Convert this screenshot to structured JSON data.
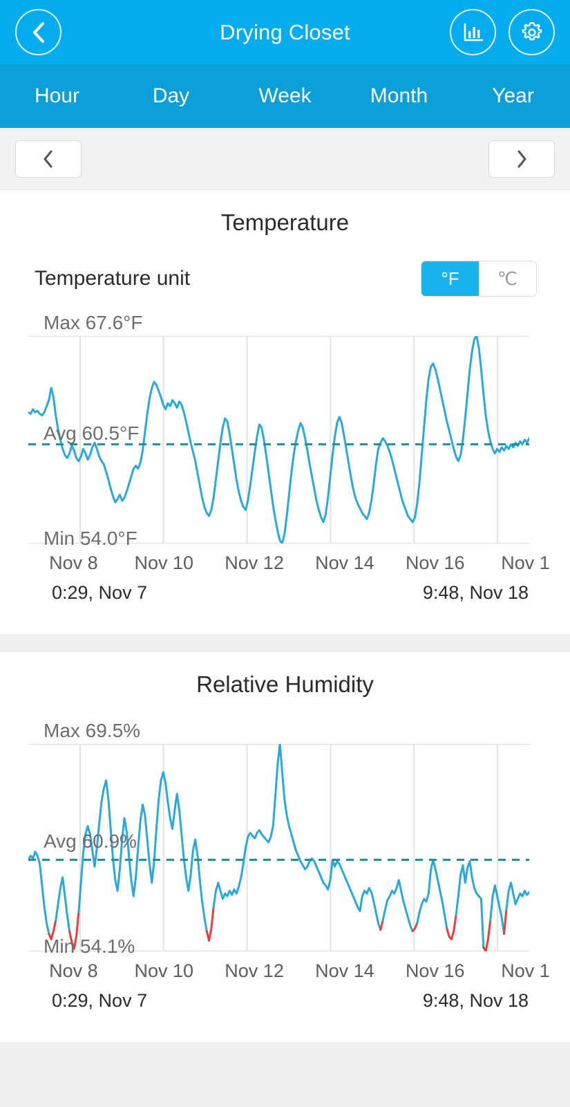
{
  "appbar": {
    "title": "Drying Closet",
    "back_icon": "chevron-left-icon",
    "chart_icon": "bar-chart-icon",
    "settings_icon": "gear-icon",
    "bg_color": "#05aced"
  },
  "tabs": [
    {
      "label": "Hour",
      "active": false
    },
    {
      "label": "Day",
      "active": false
    },
    {
      "label": "Week",
      "active": false
    },
    {
      "label": "Month",
      "active": false
    },
    {
      "label": "Year",
      "active": false
    }
  ],
  "pager": {
    "prev_icon": "chevron-left-icon",
    "next_icon": "chevron-right-icon"
  },
  "temperature_card": {
    "title": "Temperature",
    "unit_label": "Temperature unit",
    "unit_options": [
      {
        "label": "°F",
        "selected": true
      },
      {
        "label": "℃",
        "selected": false
      }
    ],
    "max_label": "Max 67.6°F",
    "avg_label": "Avg 60.5°F",
    "min_label": "Min 54.0°F",
    "range_start": "0:29, Nov 7",
    "range_end": "9:48, Nov 18"
  },
  "humidity_card": {
    "title": "Relative Humidity",
    "max_label": "Max 69.5%",
    "avg_label": "Avg 60.9%",
    "min_label": "Min 54.1%",
    "range_start": "0:29, Nov 7",
    "range_end": "9:48, Nov 18"
  },
  "colors": {
    "accent": "#05aced",
    "line_blue": "#29a8dc",
    "line_red": "#ee3b3b",
    "avg_dash": "#1f8ca8",
    "grid": "#dcdcdc"
  },
  "chart_data": [
    {
      "type": "line",
      "title": "Temperature",
      "ylabel": "°F",
      "xlabel": "",
      "grid": true,
      "legend": "none",
      "ylim": [
        54.0,
        67.6
      ],
      "stats": {
        "max": 67.6,
        "avg": 60.5,
        "min": 54.0,
        "unit": "°F"
      },
      "x_tick_labels": [
        "Nov 8",
        "Nov 10",
        "Nov 12",
        "Nov 14",
        "Nov 16",
        "Nov 1"
      ],
      "x_range": [
        "0:29, Nov 7",
        "9:48, Nov 18"
      ],
      "series": [
        {
          "name": "Temperature",
          "color": "#29a8dc",
          "values": [
            62.6,
            62.5,
            62.8,
            62.6,
            62.7,
            62.5,
            62.4,
            62.6,
            63.0,
            63.4,
            64.2,
            63.6,
            62.4,
            61.5,
            60.8,
            60.2,
            59.8,
            59.6,
            59.9,
            60.4,
            60.1,
            59.6,
            59.4,
            59.7,
            60.2,
            59.9,
            59.5,
            59.8,
            60.3,
            60.6,
            60.2,
            59.7,
            59.4,
            59.2,
            58.7,
            58.2,
            57.6,
            57.1,
            56.7,
            56.9,
            57.2,
            56.8,
            57.0,
            57.4,
            57.9,
            58.4,
            58.9,
            59.1,
            58.9,
            59.3,
            60.1,
            61.3,
            62.5,
            63.5,
            64.2,
            64.6,
            64.4,
            64.0,
            63.6,
            63.1,
            62.8,
            63.2,
            63.0,
            63.4,
            63.2,
            62.9,
            63.3,
            63.1,
            62.6,
            62.0,
            61.3,
            60.6,
            60.0,
            59.4,
            58.6,
            57.8,
            57.0,
            56.4,
            56.0,
            55.8,
            56.2,
            57.0,
            58.2,
            59.4,
            60.6,
            61.6,
            62.2,
            62.0,
            61.2,
            60.2,
            59.2,
            58.2,
            57.4,
            56.8,
            56.4,
            56.2,
            56.8,
            57.8,
            58.9,
            60.0,
            61.0,
            61.8,
            61.6,
            60.8,
            59.8,
            58.7,
            57.6,
            56.5,
            55.6,
            54.8,
            54.2,
            54.0,
            54.6,
            55.8,
            57.2,
            58.6,
            59.8,
            60.7,
            61.4,
            61.9,
            61.6,
            60.9,
            60.1,
            59.2,
            58.4,
            57.6,
            56.8,
            56.2,
            55.7,
            55.4,
            55.9,
            57.0,
            58.4,
            59.8,
            61.0,
            61.9,
            62.3,
            61.9,
            61.1,
            60.2,
            59.3,
            58.4,
            57.6,
            57.0,
            56.6,
            56.3,
            56.0,
            55.8,
            55.6,
            56.0,
            56.8,
            57.9,
            59.2,
            60.2,
            60.6,
            60.9,
            60.7,
            60.4,
            60.0,
            59.5,
            58.9,
            58.3,
            57.7,
            57.1,
            56.6,
            56.2,
            55.8,
            55.6,
            55.4,
            55.7,
            56.6,
            58.0,
            59.8,
            61.6,
            63.4,
            64.8,
            65.6,
            65.8,
            65.4,
            64.8,
            64.1,
            63.4,
            62.7,
            62.0,
            61.4,
            60.8,
            60.2,
            59.7,
            59.4,
            59.8,
            60.8,
            62.2,
            63.8,
            65.4,
            66.6,
            67.4,
            67.6,
            66.8,
            65.4,
            63.8,
            62.4,
            61.4,
            60.7,
            60.2,
            59.9,
            60.2,
            60.0,
            60.3,
            60.1,
            60.4,
            60.2,
            60.5,
            60.3,
            60.6,
            60.4,
            60.7,
            60.5,
            60.8,
            60.6,
            60.9
          ]
        }
      ],
      "avg_line": 60.5
    },
    {
      "type": "line",
      "title": "Relative Humidity",
      "ylabel": "%",
      "xlabel": "",
      "grid": true,
      "legend": "none",
      "ylim": [
        54.1,
        69.5
      ],
      "stats": {
        "max": 69.5,
        "avg": 60.9,
        "min": 54.1,
        "unit": "%"
      },
      "x_tick_labels": [
        "Nov 8",
        "Nov 10",
        "Nov 12",
        "Nov 14",
        "Nov 16",
        "Nov 1"
      ],
      "x_range": [
        "0:29, Nov 7",
        "9:48, Nov 18"
      ],
      "threshold_low": 56.0,
      "series": [
        {
          "name": "Relative Humidity",
          "color": "#29a8dc",
          "below_threshold_color": "#ee3b3b",
          "values": [
            60.9,
            61.2,
            61.0,
            61.5,
            61.2,
            60.6,
            59.0,
            57.4,
            56.2,
            55.4,
            55.0,
            55.6,
            56.4,
            57.6,
            58.8,
            59.6,
            58.2,
            56.8,
            55.6,
            54.8,
            54.3,
            55.2,
            57.0,
            59.2,
            61.4,
            62.8,
            63.4,
            62.8,
            61.6,
            60.4,
            61.8,
            63.6,
            65.2,
            66.2,
            66.8,
            65.4,
            63.2,
            61.0,
            59.4,
            58.6,
            60.2,
            62.4,
            64.0,
            63.0,
            61.2,
            59.4,
            58.2,
            59.6,
            61.8,
            63.8,
            65.0,
            64.2,
            62.4,
            60.6,
            59.2,
            60.8,
            63.2,
            65.4,
            66.8,
            67.4,
            66.6,
            65.2,
            64.0,
            63.2,
            64.6,
            65.8,
            64.6,
            62.8,
            61.0,
            59.6,
            58.6,
            59.8,
            61.6,
            62.4,
            61.2,
            59.4,
            57.8,
            56.6,
            55.6,
            54.9,
            55.8,
            57.4,
            58.6,
            59.2,
            58.6,
            58.0,
            58.4,
            58.2,
            58.6,
            58.3,
            58.7,
            58.4,
            58.9,
            59.6,
            60.6,
            61.8,
            62.6,
            62.9,
            62.7,
            62.5,
            62.9,
            63.1,
            62.8,
            62.6,
            62.4,
            62.2,
            62.6,
            63.4,
            65.6,
            68.0,
            69.5,
            67.4,
            65.4,
            64.2,
            63.4,
            62.8,
            62.2,
            61.6,
            61.2,
            60.8,
            60.5,
            60.2,
            60.4,
            60.8,
            61.0,
            60.8,
            60.4,
            60.0,
            59.6,
            59.2,
            59.0,
            58.7,
            59.4,
            60.9,
            60.4,
            60.8,
            60.6,
            60.2,
            59.8,
            59.4,
            59.0,
            58.6,
            58.2,
            57.8,
            57.4,
            57.1,
            58.2,
            58.6,
            58.4,
            58.8,
            58.5,
            57.8,
            57.0,
            56.2,
            55.7,
            56.4,
            57.2,
            57.9,
            58.2,
            58.6,
            58.4,
            58.8,
            59.4,
            58.6,
            57.8,
            57.2,
            56.6,
            56.0,
            55.6,
            55.8,
            56.2,
            57.0,
            57.6,
            58.0,
            57.8,
            58.4,
            60.2,
            60.9,
            60.2,
            59.4,
            58.6,
            57.8,
            56.8,
            55.8,
            55.2,
            55.0,
            55.6,
            56.8,
            58.2,
            59.8,
            60.5,
            59.2,
            60.3,
            60.8,
            59.6,
            58.8,
            58.4,
            58.2,
            58.0,
            54.4,
            54.1,
            55.0,
            56.4,
            58.2,
            59.0,
            58.2,
            57.4,
            56.6,
            55.4,
            57.2,
            58.6,
            59.2,
            58.4,
            57.6,
            58.0,
            58.4,
            58.2,
            58.6,
            58.3,
            58.5
          ]
        }
      ],
      "avg_line": 60.9
    }
  ]
}
